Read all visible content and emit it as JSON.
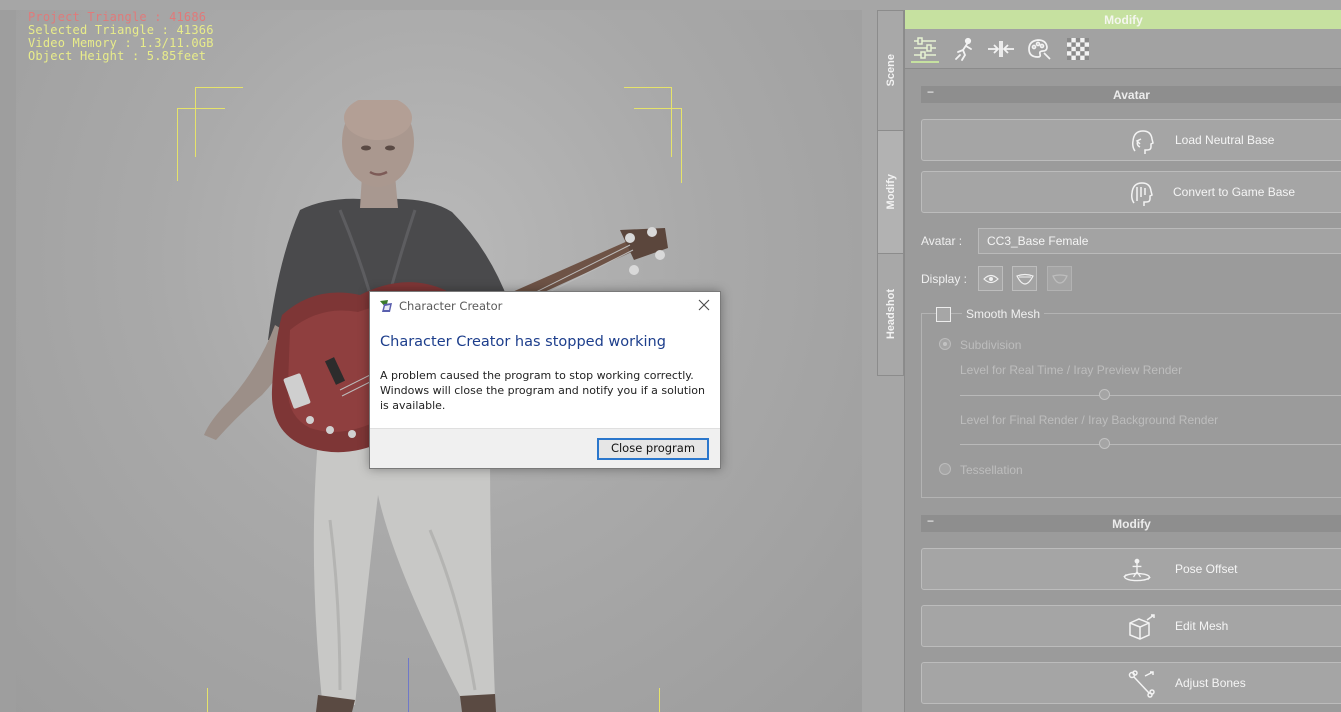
{
  "viewport": {
    "stats": {
      "project_triangle": "Project Triangle : 41686",
      "selected_triangle": "Selected Triangle : 41366",
      "video_memory": "Video Memory : 1.3/11.0GB",
      "object_height": "Object Height : 5.85feet"
    }
  },
  "side_tabs": [
    "Scene",
    "Modify",
    "Headshot"
  ],
  "panel": {
    "header": "Modify",
    "toolbar_icons": [
      "sliders-icon",
      "pose-icon",
      "compress-icon",
      "paint-palette-icon",
      "checker-texture-icon"
    ],
    "avatar_section": {
      "title": "Avatar",
      "collapse": "−",
      "load_neutral_base": "Load Neutral Base",
      "convert_to_game_base": "Convert to Game Base",
      "avatar_label": "Avatar :",
      "avatar_value": "CC3_Base Female",
      "display_label": "Display :",
      "smooth_mesh": "Smooth Mesh",
      "subdivision": "Subdivision",
      "realtime_level": "Level for Real Time / Iray Preview Render",
      "final_level": "Level for Final Render / Iray Background Render",
      "tessellation": "Tessellation"
    },
    "modify_section": {
      "title": "Modify",
      "collapse": "−",
      "pose_offset": "Pose Offset",
      "edit_mesh": "Edit Mesh",
      "adjust_bones": "Adjust Bones"
    }
  },
  "dialog": {
    "title": "Character Creator",
    "heading": "Character Creator has stopped working",
    "body": "A problem caused the program to stop working correctly. Windows will close the program and notify you if a solution is available.",
    "button": "Close program"
  },
  "colors": {
    "accent_green": "#c6e1a0",
    "heading_blue": "#1d3e8c",
    "button_focus": "#2b77cc",
    "stat_red": "#e07a7a",
    "stat_yellow": "#e8ec8a"
  }
}
